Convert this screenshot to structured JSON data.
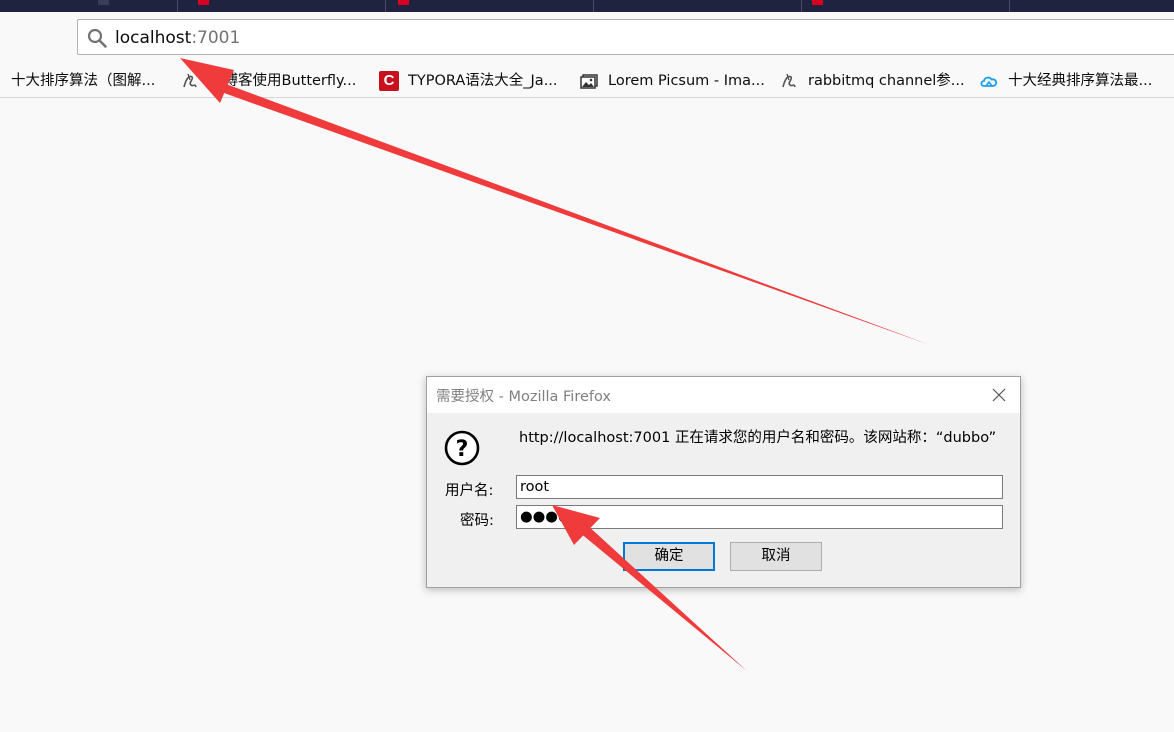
{
  "tabs": [
    {
      "favicon": "red"
    },
    {
      "favicon": "red"
    },
    {
      "favicon": "dark"
    },
    {
      "favicon": "red"
    },
    {
      "favicon": "dark"
    }
  ],
  "urlbar": {
    "host": "localhost",
    "port": ":7001",
    "icon": "search-icon"
  },
  "bookmarks": [
    {
      "label": "十大排序算法（图解...",
      "icon": "none"
    },
    {
      "label": "给博客使用Butterfly...",
      "icon": "scribble-icon"
    },
    {
      "label": "TYPORA语法大全_Ja...",
      "icon": "csdn-icon"
    },
    {
      "label": "Lorem Picsum - Ima...",
      "icon": "image-icon"
    },
    {
      "label": "rabbitmq channel参...",
      "icon": "scribble-icon"
    },
    {
      "label": "十大经典排序算法最...",
      "icon": "cloud-icon"
    }
  ],
  "dialog": {
    "title": "需要授权 - Mozilla Firefox",
    "message": "http://localhost:7001 正在请求您的用户名和密码。该网站称：“dubbo”",
    "username_label": "用户名:",
    "password_label": "密码:",
    "username_value": "root",
    "password_value": "●●●●",
    "ok_label": "确定",
    "cancel_label": "取消"
  },
  "colors": {
    "annotation_arrow": "#ef3b3b",
    "tabstrip": "#202340",
    "focus_border": "#0078d7"
  }
}
